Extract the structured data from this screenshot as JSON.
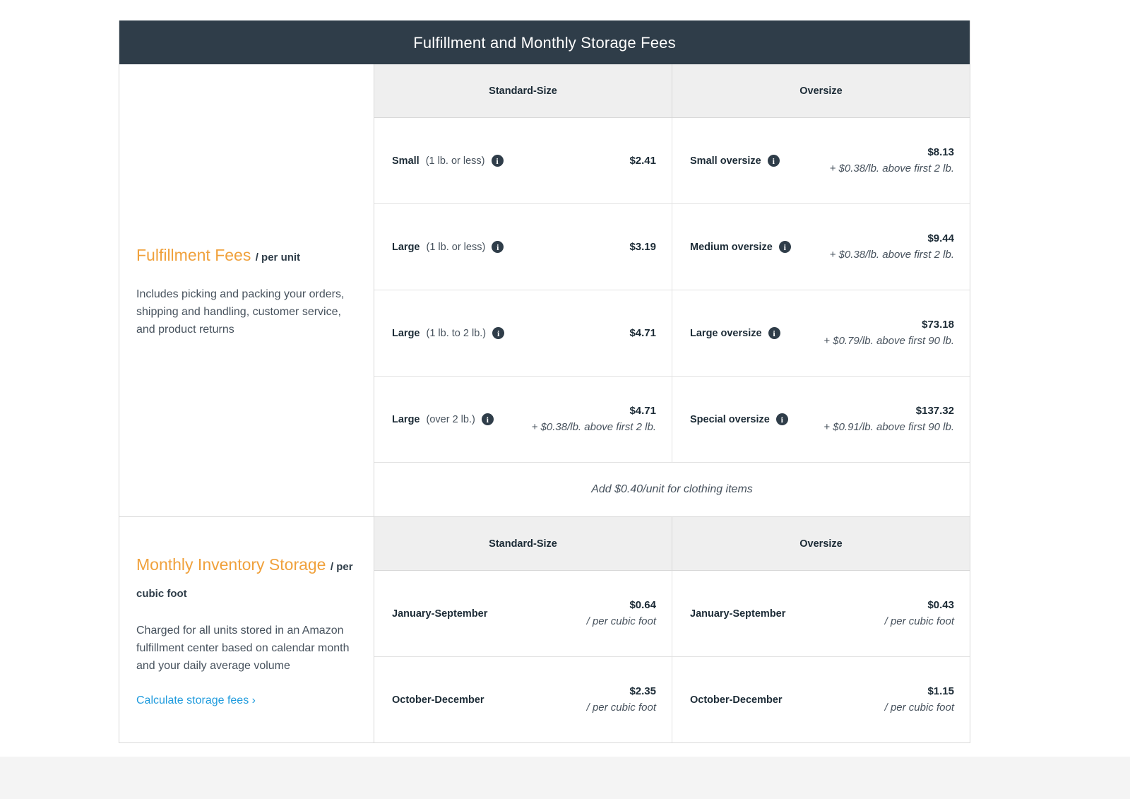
{
  "card": {
    "title": "Fulfillment and Monthly Storage Fees"
  },
  "colors": {
    "header_bg": "#2f3d49",
    "accent_orange": "#f0a13c",
    "link_blue": "#1f9bdd",
    "table_head_bg": "#efefef",
    "body_text": "#47525d"
  },
  "fulfillment": {
    "heading_accent": "Fulfillment Fees",
    "heading_sub": "/ per unit",
    "description": "Includes picking and packing your orders, shipping and handling, customer service, and product returns",
    "columns": [
      {
        "label": "Standard-Size"
      },
      {
        "label": "Oversize"
      }
    ],
    "rows": [
      {
        "standard": {
          "name_strong": "Small",
          "name_weak": "(1 lb. or less)",
          "info_icon": "info-icon",
          "amount": "$2.41",
          "extra": ""
        },
        "oversize": {
          "name_strong": "Small oversize",
          "name_weak": "",
          "info_icon": "info-icon",
          "amount": "$8.13",
          "extra": "+ $0.38/lb. above first 2 lb."
        }
      },
      {
        "standard": {
          "name_strong": "Large",
          "name_weak": "(1 lb. or less)",
          "info_icon": "info-icon",
          "amount": "$3.19",
          "extra": ""
        },
        "oversize": {
          "name_strong": "Medium oversize",
          "name_weak": "",
          "info_icon": "info-icon",
          "amount": "$9.44",
          "extra": "+ $0.38/lb. above first 2 lb."
        }
      },
      {
        "standard": {
          "name_strong": "Large",
          "name_weak": "(1 lb. to 2 lb.)",
          "info_icon": "info-icon",
          "amount": "$4.71",
          "extra": ""
        },
        "oversize": {
          "name_strong": "Large oversize",
          "name_weak": "",
          "info_icon": "info-icon",
          "amount": "$73.18",
          "extra": "+ $0.79/lb. above first 90 lb."
        }
      },
      {
        "standard": {
          "name_strong": "Large",
          "name_weak": "(over 2 lb.)",
          "info_icon": "info-icon",
          "amount": "$4.71",
          "extra": "+ $0.38/lb. above first 2 lb."
        },
        "oversize": {
          "name_strong": "Special oversize",
          "name_weak": "",
          "info_icon": "info-icon",
          "amount": "$137.32",
          "extra": "+ $0.91/lb. above first 90 lb."
        }
      }
    ],
    "note": "Add $0.40/unit for clothing items"
  },
  "storage": {
    "heading_accent": "Monthly Inventory Storage",
    "heading_sub": "/ per cubic foot",
    "description": "Charged for all units stored in an Amazon fulfillment center based on calendar month and your daily average volume",
    "link_label": "Calculate storage fees ›",
    "columns": [
      {
        "label": "Standard-Size"
      },
      {
        "label": "Oversize"
      }
    ],
    "rows": [
      {
        "standard": {
          "name_strong": "January-September",
          "amount": "$0.64",
          "unit": "/ per cubic foot"
        },
        "oversize": {
          "name_strong": "January-September",
          "amount": "$0.43",
          "unit": "/ per cubic foot"
        }
      },
      {
        "standard": {
          "name_strong": "October-December",
          "amount": "$2.35",
          "unit": "/ per cubic foot"
        },
        "oversize": {
          "name_strong": "October-December",
          "amount": "$1.15",
          "unit": "/ per cubic foot"
        }
      }
    ]
  }
}
